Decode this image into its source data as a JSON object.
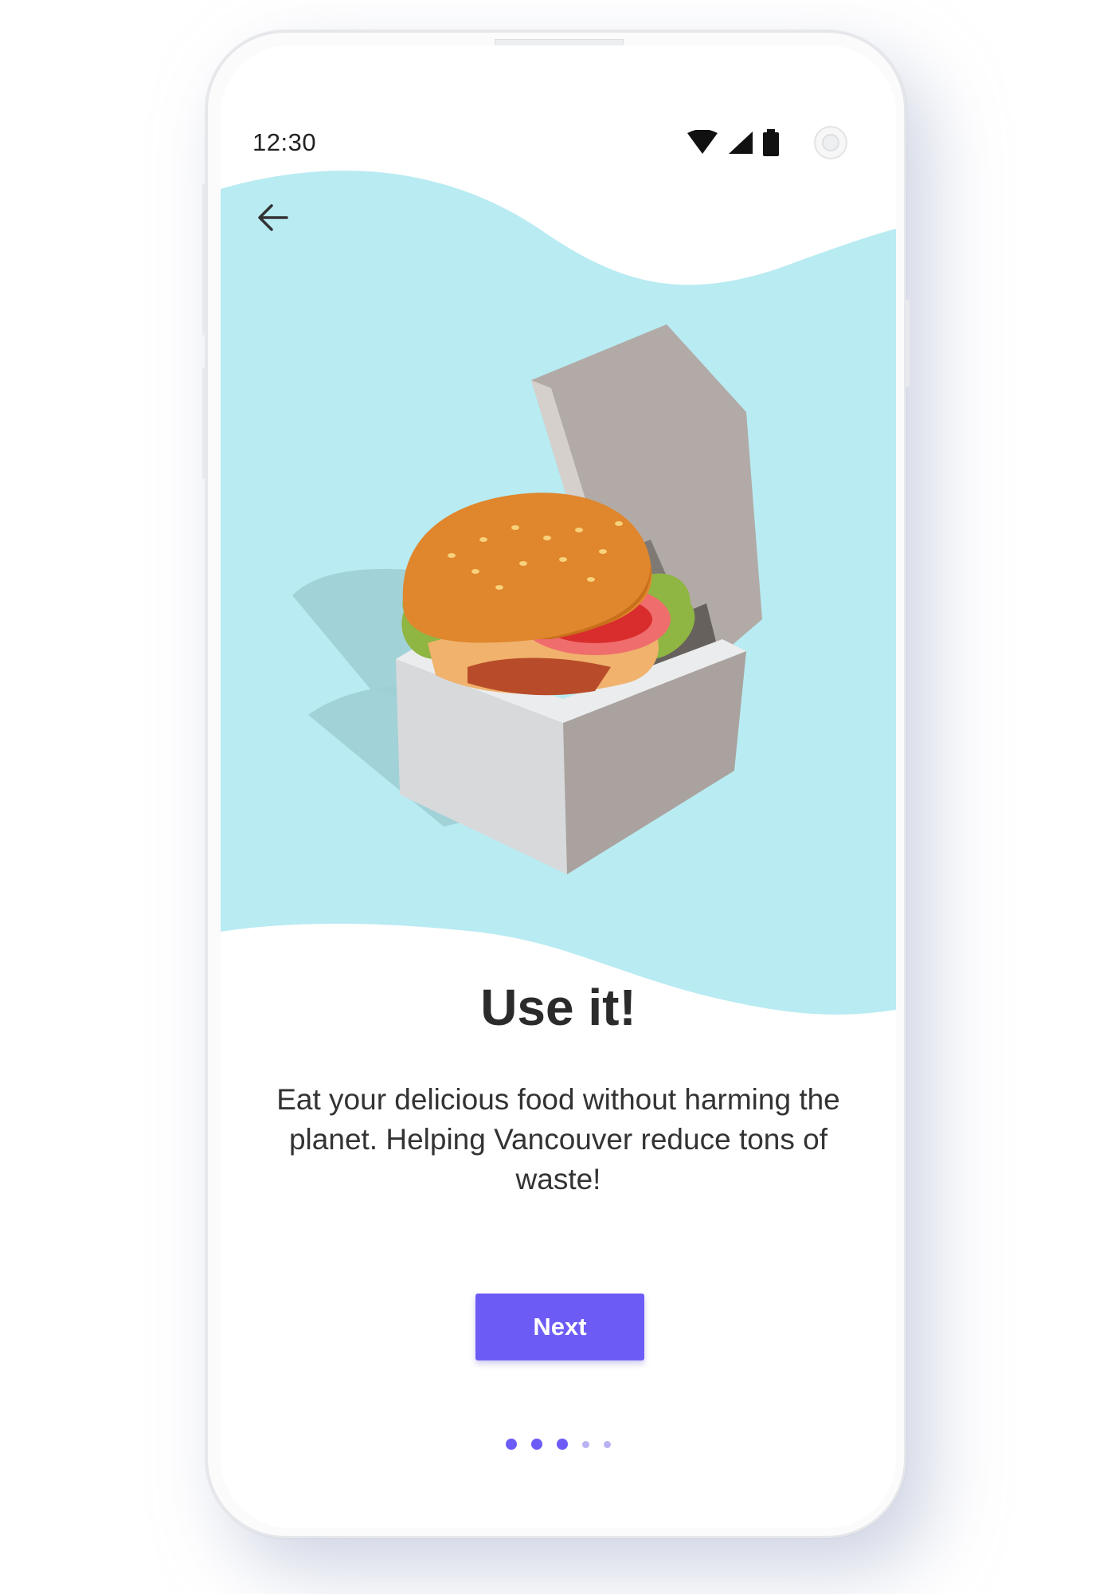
{
  "status_bar": {
    "time": "12:30",
    "icons": [
      "wifi-icon",
      "cell-signal-icon",
      "battery-icon"
    ]
  },
  "header": {
    "back_icon": "arrow-left-icon"
  },
  "onboarding": {
    "title": "Use it!",
    "description": "Eat your delicious food without harming the planet. Helping Vancouver reduce tons of waste!",
    "next_label": "Next",
    "pagination": {
      "total": 5,
      "active_count": 3
    }
  },
  "colors": {
    "accent": "#6c5cf5",
    "wave": "#b8ebf2",
    "text_dark": "#2b2b2b"
  }
}
